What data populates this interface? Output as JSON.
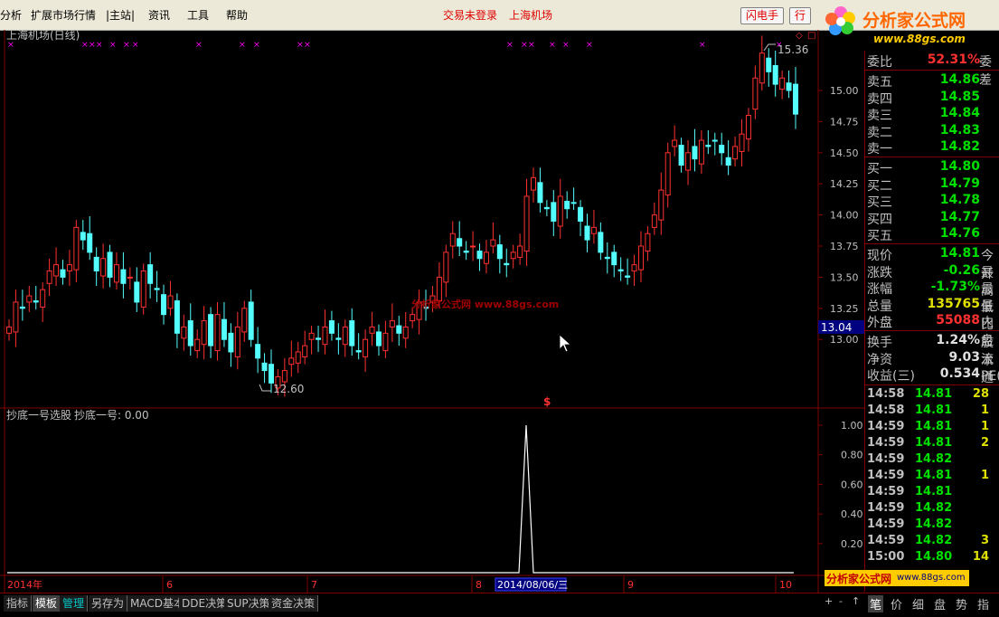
{
  "menu": {
    "items": [
      "分析",
      "扩展市场行情",
      "|主站|",
      "资讯",
      "工具",
      "帮助"
    ],
    "status_trade": "交易未登录",
    "status_stock": "上海机场",
    "flash_button": "闪电手",
    "row_button": "行"
  },
  "logo": {
    "title": "分析家公式网",
    "url": "www.88gs.com"
  },
  "chart": {
    "title": "上海机场(日线)",
    "high_label": "15.36",
    "low_label": "12.60",
    "watermark": "分析家公式网 www.88gs.com",
    "y_ticks": [
      "15.00",
      "14.75",
      "14.50",
      "14.25",
      "14.00",
      "13.75",
      "13.50",
      "13.25",
      "13.00"
    ],
    "cursor_price": "13.04",
    "dollar_marker": "$",
    "indicator_title": "抄底一号选股",
    "indicator_value": "抄底一号: 0.00",
    "indicator_ticks": [
      "1.00",
      "0.80",
      "0.60",
      "0.40",
      "0.20"
    ],
    "x_labels": [
      "2014年",
      "6",
      "7",
      "8",
      "9",
      "10"
    ],
    "cursor_date": "2014/08/06/三"
  },
  "quote": {
    "weibi": {
      "label": "委比",
      "value": "52.31%",
      "right": "委差"
    },
    "sell": [
      {
        "label": "卖五",
        "value": "14.86"
      },
      {
        "label": "卖四",
        "value": "14.85"
      },
      {
        "label": "卖三",
        "value": "14.84"
      },
      {
        "label": "卖二",
        "value": "14.83"
      },
      {
        "label": "卖一",
        "value": "14.82"
      }
    ],
    "buy": [
      {
        "label": "买一",
        "value": "14.80"
      },
      {
        "label": "买二",
        "value": "14.79"
      },
      {
        "label": "买三",
        "value": "14.78"
      },
      {
        "label": "买四",
        "value": "14.77"
      },
      {
        "label": "买五",
        "value": "14.76"
      }
    ],
    "stats": [
      {
        "label": "现价",
        "value": "14.81",
        "right": "今开",
        "color": "#00e000"
      },
      {
        "label": "涨跌",
        "value": "-0.26",
        "right": "最高",
        "color": "#00e000"
      },
      {
        "label": "涨幅",
        "value": "-1.73%",
        "right": "最低",
        "color": "#00e000"
      },
      {
        "label": "总量",
        "value": "135765",
        "right": "量比",
        "color": "#e0e000"
      },
      {
        "label": "外盘",
        "value": "55088",
        "right": "内盘",
        "color": "#ff3030"
      }
    ],
    "stats2": [
      {
        "label": "换手",
        "value": "1.24%",
        "right": "股本"
      },
      {
        "label": "净资",
        "value": "9.03",
        "right": "流通"
      },
      {
        "label": "收益(三)",
        "value": "0.534",
        "right": "PE(动"
      }
    ],
    "ticks": [
      {
        "time": "14:58",
        "price": "14.81",
        "vol": "28"
      },
      {
        "time": "14:58",
        "price": "14.81",
        "vol": "1"
      },
      {
        "time": "14:59",
        "price": "14.81",
        "vol": "1"
      },
      {
        "time": "14:59",
        "price": "14.81",
        "vol": "2"
      },
      {
        "time": "14:59",
        "price": "14.82",
        "vol": ""
      },
      {
        "time": "14:59",
        "price": "14.81",
        "vol": "1"
      },
      {
        "time": "14:59",
        "price": "14.81",
        "vol": ""
      },
      {
        "time": "14:59",
        "price": "14.82",
        "vol": ""
      },
      {
        "time": "14:59",
        "price": "14.82",
        "vol": ""
      },
      {
        "time": "14:59",
        "price": "14.82",
        "vol": "3"
      },
      {
        "time": "15:00",
        "price": "14.80",
        "vol": "14"
      }
    ]
  },
  "bottom": {
    "tabs": [
      "指标",
      "模板",
      "管理",
      "另存为",
      "MACD基本",
      "DDE决策",
      "SUP决策",
      "资金决策"
    ],
    "right_tabs": [
      "笔",
      "价",
      "细",
      "盘",
      "势",
      "指"
    ],
    "nav": [
      "+",
      "-",
      "↑"
    ]
  },
  "banner": {
    "text": "分析家公式网",
    "url": "www.88gs.com"
  },
  "colors": {
    "up": "#ff3030",
    "down": "#54ffff",
    "axis": "#800000",
    "tick_text": "#c0c0c0"
  }
}
